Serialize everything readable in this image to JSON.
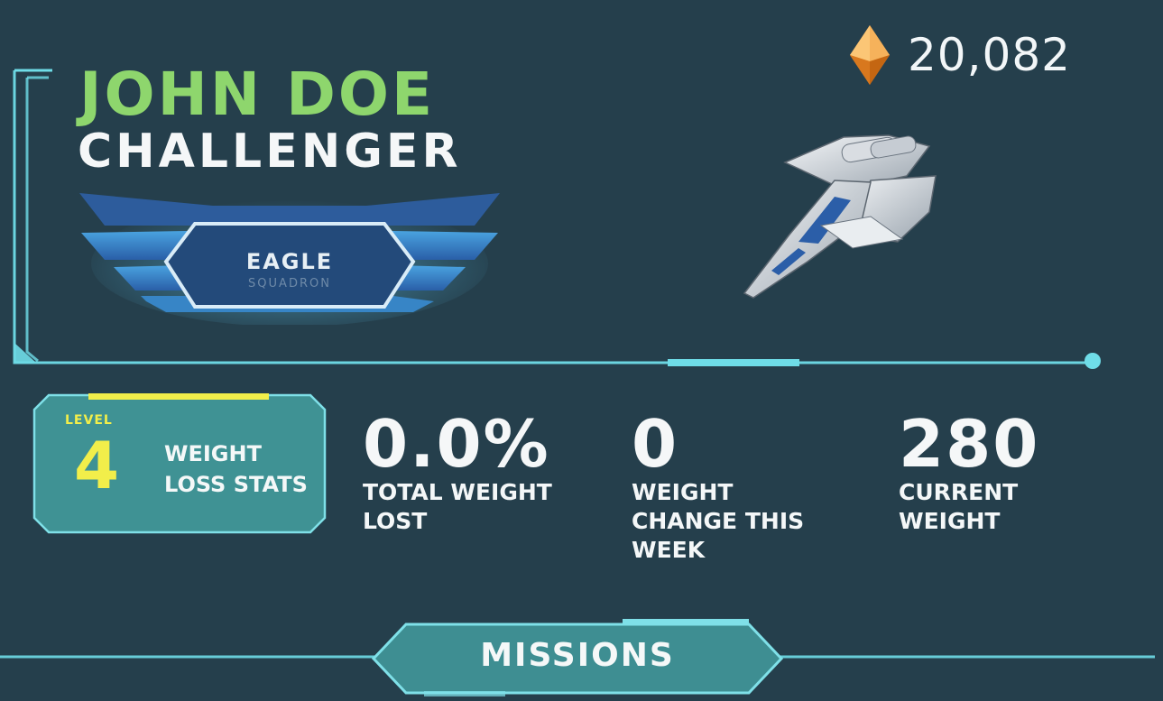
{
  "currency": {
    "icon": "orange-gem-icon",
    "amount": "20,082",
    "gem_color": "#f39a3a"
  },
  "player": {
    "name": "JOHN DOE",
    "rank": "CHALLENGER",
    "name_color": "#8ed66d"
  },
  "squadron": {
    "name": "EAGLE",
    "subtitle": "SQUADRON"
  },
  "ship": {
    "icon": "spaceship-icon"
  },
  "level_panel": {
    "level_label": "LEVEL",
    "level_value": "4",
    "title": "WEIGHT LOSS STATS",
    "accent_color": "#f2ee4a"
  },
  "stats": [
    {
      "value": "0.0%",
      "label": "TOTAL WEIGHT LOST"
    },
    {
      "value": "0",
      "label": "WEIGHT CHANGE THIS WEEK"
    },
    {
      "value": "280",
      "label": "CURRENT WEIGHT"
    }
  ],
  "missions": {
    "label": "MISSIONS"
  },
  "colors": {
    "background": "#253f4c",
    "frame_line": "#6fdde8",
    "panel_fill": "#3f9294"
  }
}
